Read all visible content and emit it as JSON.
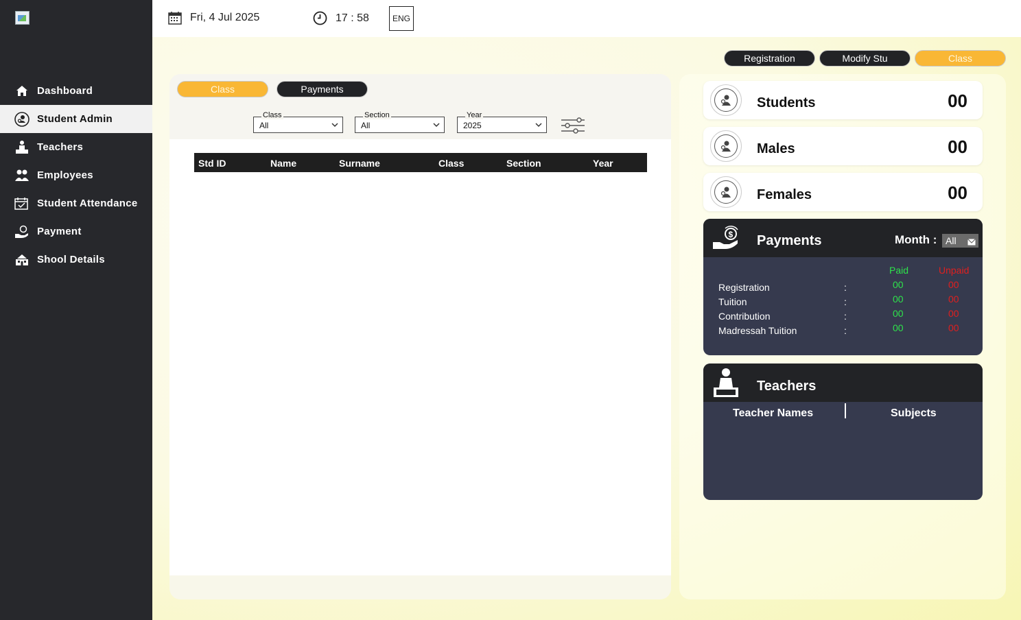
{
  "sidebar": {
    "items": [
      {
        "label": "Dashboard",
        "icon": "home-icon"
      },
      {
        "label": "Student Admin",
        "icon": "student-admin-icon"
      },
      {
        "label": "Teachers",
        "icon": "teacher-icon"
      },
      {
        "label": "Employees",
        "icon": "employees-icon"
      },
      {
        "label": "Student Attendance",
        "icon": "attendance-icon"
      },
      {
        "label": "Payment",
        "icon": "payment-icon"
      },
      {
        "label": "Shool Details",
        "icon": "school-icon"
      }
    ]
  },
  "topbar": {
    "date": "Fri, 4 Jul 2025",
    "time": "17 : 58",
    "language": "ENG"
  },
  "top_tabs": {
    "registration": "Registration",
    "modify": "Modify Stu",
    "class": "Class"
  },
  "panel_tabs": {
    "class": "Class",
    "payments": "Payments"
  },
  "filters": {
    "class": {
      "label": "Class",
      "value": "All"
    },
    "section": {
      "label": "Section",
      "value": "All"
    },
    "year": {
      "label": "Year",
      "value": "2025"
    }
  },
  "table": {
    "columns": [
      "Std ID",
      "Name",
      "Surname",
      "Class",
      "Section",
      "Year"
    ],
    "rows": []
  },
  "stats": {
    "students": {
      "label": "Students",
      "value": "00"
    },
    "males": {
      "label": "Males",
      "value": "00"
    },
    "females": {
      "label": "Females",
      "value": "00"
    }
  },
  "payments": {
    "title": "Payments",
    "month_label": "Month :",
    "month_value": "All",
    "paid_label": "Paid",
    "unpaid_label": "Unpaid",
    "separator": ":",
    "rows": [
      {
        "label": "Registration",
        "paid": "00",
        "unpaid": "00"
      },
      {
        "label": "Tuition",
        "paid": "00",
        "unpaid": "00"
      },
      {
        "label": "Contribution",
        "paid": "00",
        "unpaid": "00"
      },
      {
        "label": "Madressah Tuition",
        "paid": "00",
        "unpaid": "00"
      }
    ]
  },
  "teachers": {
    "title": "Teachers",
    "col_names": "Teacher Names",
    "col_subjects": "Subjects"
  },
  "colors": {
    "sidebar_bg": "#27282c",
    "accent_orange": "#f9b735",
    "dark_card": "#363a4e",
    "paid_green": "#2ee24b",
    "unpaid_red": "#e01f1f"
  }
}
